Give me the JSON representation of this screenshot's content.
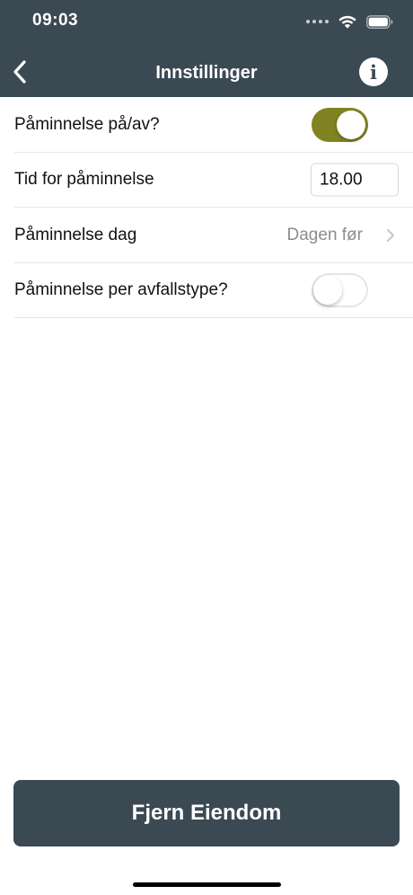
{
  "status_bar": {
    "time": "09:03",
    "signal_icon": "signal-dots-icon",
    "wifi_icon": "wifi-icon",
    "battery_icon": "battery-icon"
  },
  "navbar": {
    "title": "Innstillinger",
    "back_icon": "chevron-left-icon",
    "info_icon": "info-icon",
    "info_glyph": "i"
  },
  "settings": {
    "reminder_toggle": {
      "label": "Påminnelse på/av?",
      "state": "on"
    },
    "reminder_time": {
      "label": "Tid for påminnelse",
      "value": "18.00"
    },
    "reminder_day": {
      "label": "Påminnelse dag",
      "value": "Dagen før"
    },
    "per_waste_type": {
      "label": "Påminnelse per avfallstype?",
      "state": "off"
    }
  },
  "footer": {
    "remove_property_label": "Fjern Eiendom"
  },
  "colors": {
    "header_bg": "#3b4953",
    "toggle_on": "#818322",
    "button_bg": "#3b4953",
    "secondary_text": "#8a8d90"
  }
}
